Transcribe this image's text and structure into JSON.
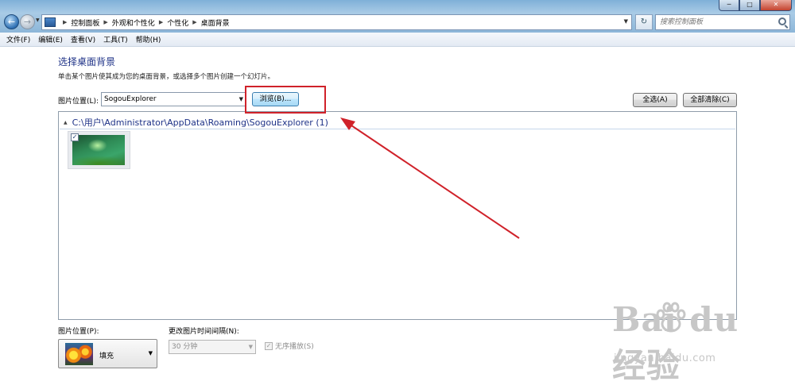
{
  "window": {
    "minimize": "─",
    "maximize": "□",
    "close": "✕"
  },
  "address_bar": {
    "breadcrumbs": [
      "控制面板",
      "外观和个性化",
      "个性化",
      "桌面背景"
    ]
  },
  "search": {
    "placeholder": "搜索控制面板"
  },
  "menu": {
    "items": [
      "文件(F)",
      "编辑(E)",
      "查看(V)",
      "工具(T)",
      "帮助(H)"
    ]
  },
  "main": {
    "title": "选择桌面背景",
    "description": "单击某个图片使其成为您的桌面背景，或选择多个图片创建一个幻灯片。",
    "location_label": "图片位置(L):",
    "location_value": "SogouExplorer",
    "browse_button": "浏览(B)...",
    "select_all_button": "全选(A)",
    "clear_all_button": "全部清除(C)"
  },
  "gallery": {
    "group_path": "C:\\用户\\Administrator\\AppData\\Roaming\\SogouExplorer (1)",
    "items": [
      {
        "checked": true,
        "check_mark": "✓"
      }
    ]
  },
  "bottom": {
    "position_label": "图片位置(P):",
    "position_value": "填充",
    "interval_label": "更改图片时间间隔(N):",
    "interval_value": "30 分钟",
    "shuffle_label": "无序播放(S)",
    "shuffle_checked": true,
    "shuffle_mark": "✓"
  },
  "watermark": {
    "brand": "Bai  du 经验",
    "url": "jingyan.baidu.com"
  },
  "annotation": {
    "color": "#d0222a"
  }
}
